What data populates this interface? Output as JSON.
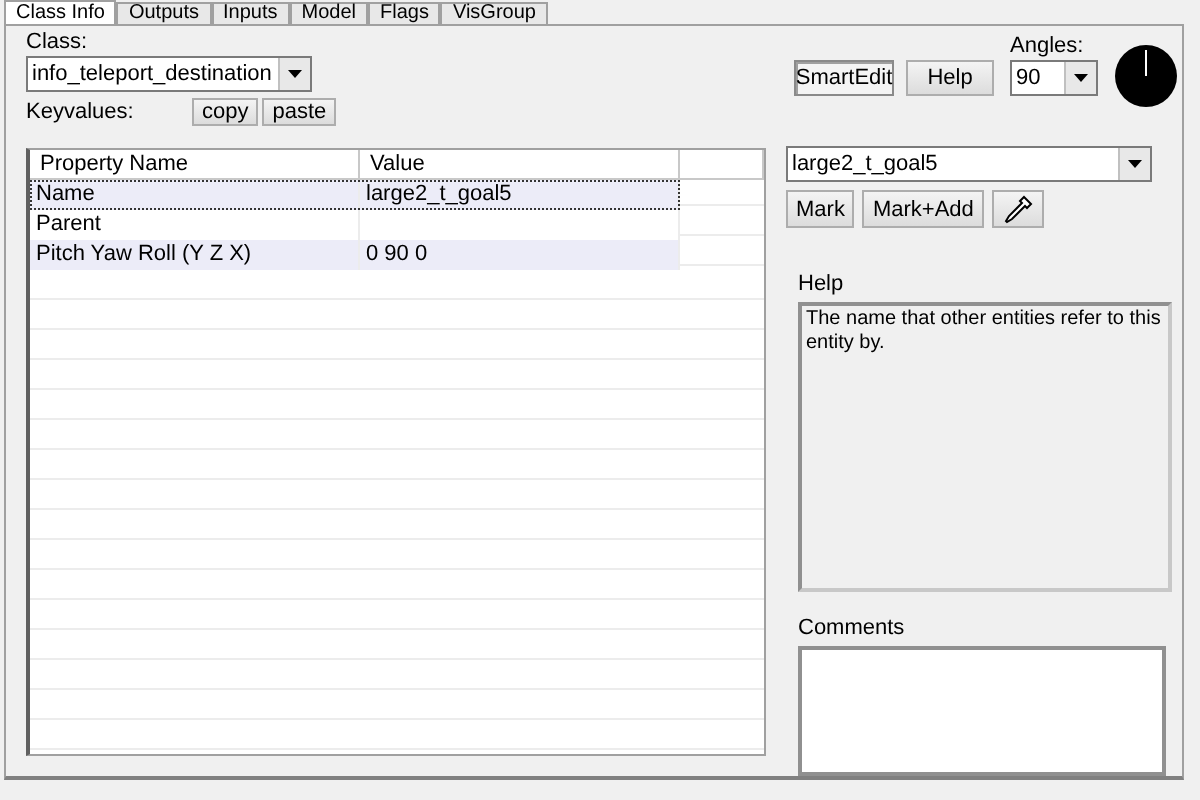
{
  "tabs": [
    {
      "label": "Class Info",
      "selected": true
    },
    {
      "label": "Outputs",
      "selected": false
    },
    {
      "label": "Inputs",
      "selected": false
    },
    {
      "label": "Model",
      "selected": false
    },
    {
      "label": "Flags",
      "selected": false
    },
    {
      "label": "VisGroup",
      "selected": false
    }
  ],
  "class_field": {
    "label": "Class:",
    "value": "info_teleport_destination"
  },
  "keyvalues": {
    "label": "Keyvalues:",
    "buttons": [
      "copy",
      "paste"
    ]
  },
  "table": {
    "columns": [
      "Property Name",
      "Value"
    ],
    "rows": [
      {
        "cells": [
          "Name",
          "large2_t_goal5"
        ],
        "selected": true
      },
      {
        "cells": [
          "Parent",
          ""
        ],
        "selected": false
      },
      {
        "cells": [
          "Pitch Yaw Roll (Y Z X)",
          "0 90 0"
        ],
        "selected": false
      }
    ]
  },
  "smartedit": {
    "label": "SmartEdit",
    "on": true
  },
  "help_button": "Help",
  "angles": {
    "label": "Angles:",
    "value": "90"
  },
  "target_field": {
    "value": "large2_t_goal5"
  },
  "mark_buttons": [
    "Mark",
    "Mark+Add"
  ],
  "help": {
    "label": "Help",
    "text": "The name that other entities refer to this entity by."
  },
  "comments": {
    "label": "Comments"
  }
}
